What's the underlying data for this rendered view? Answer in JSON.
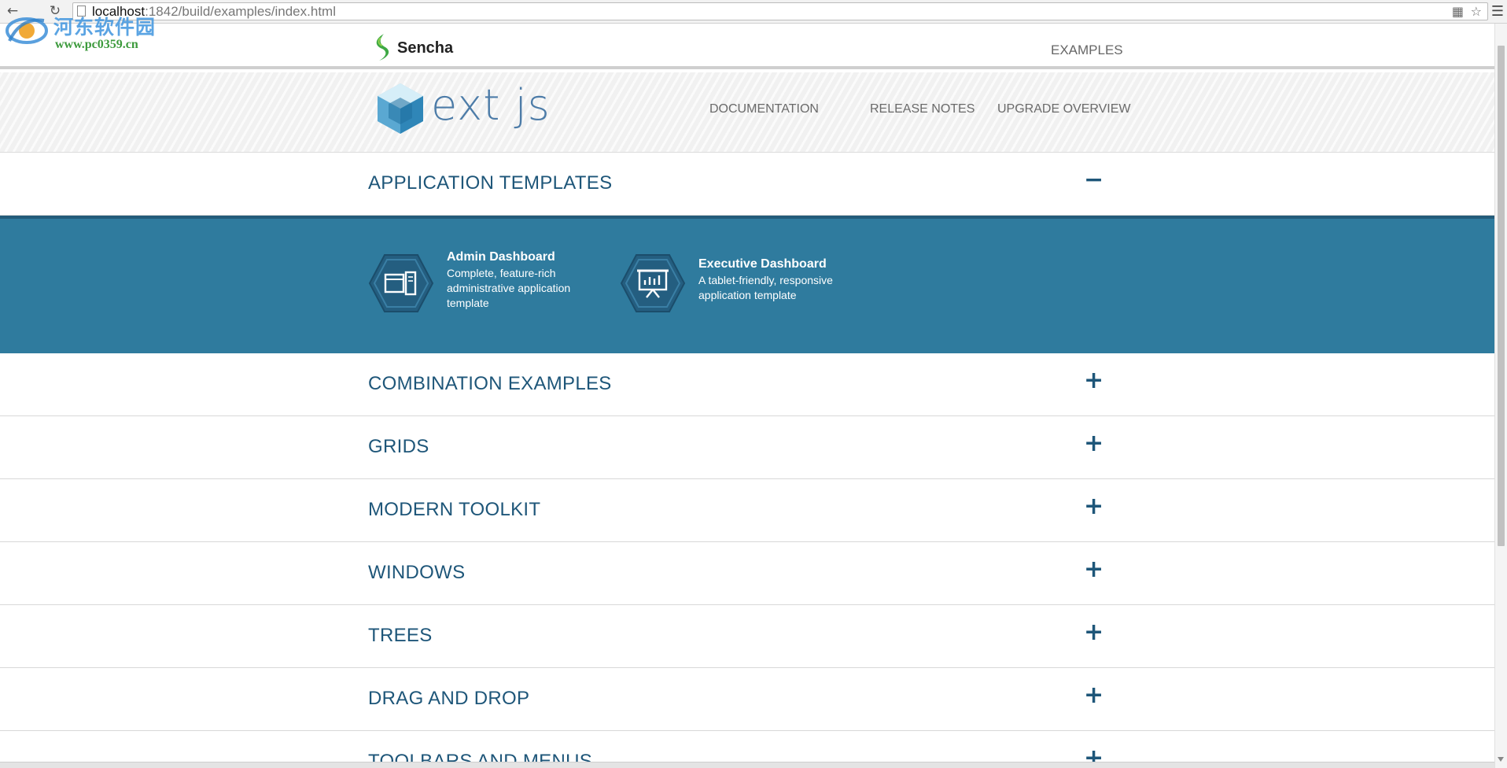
{
  "browser": {
    "url_host": "localhost",
    "url_path": ":1842/build/examples/index.html"
  },
  "watermark": {
    "site_name": "河东软件园",
    "site_url": "www.pc0359.cn"
  },
  "header": {
    "brand": "Sencha",
    "nav_examples": "EXAMPLES"
  },
  "hero": {
    "product": "ext js",
    "nav": [
      "DOCUMENTATION",
      "RELEASE NOTES",
      "UPGRADE OVERVIEW"
    ]
  },
  "sections": [
    {
      "title": "APPLICATION TEMPLATES",
      "state": "expanded",
      "toggle": "−"
    },
    {
      "title": "COMBINATION EXAMPLES",
      "state": "collapsed",
      "toggle": "+"
    },
    {
      "title": "GRIDS",
      "state": "collapsed",
      "toggle": "+"
    },
    {
      "title": "MODERN TOOLKIT",
      "state": "collapsed",
      "toggle": "+"
    },
    {
      "title": "WINDOWS",
      "state": "collapsed",
      "toggle": "+"
    },
    {
      "title": "TREES",
      "state": "collapsed",
      "toggle": "+"
    },
    {
      "title": "DRAG AND DROP",
      "state": "collapsed",
      "toggle": "+"
    },
    {
      "title": "TOOLBARS AND MENUS",
      "state": "collapsed",
      "toggle": "+"
    }
  ],
  "templates": [
    {
      "title": "Admin Dashboard",
      "desc": "Complete, feature-rich administrative application template",
      "icon": "dashboard-layout-icon"
    },
    {
      "title": "Executive Dashboard",
      "desc": "A tablet-friendly, responsive application template",
      "icon": "presentation-chart-icon"
    }
  ],
  "colors": {
    "accent": "#1e5679",
    "panel": "#2f7b9e",
    "hex": "#245e80"
  }
}
